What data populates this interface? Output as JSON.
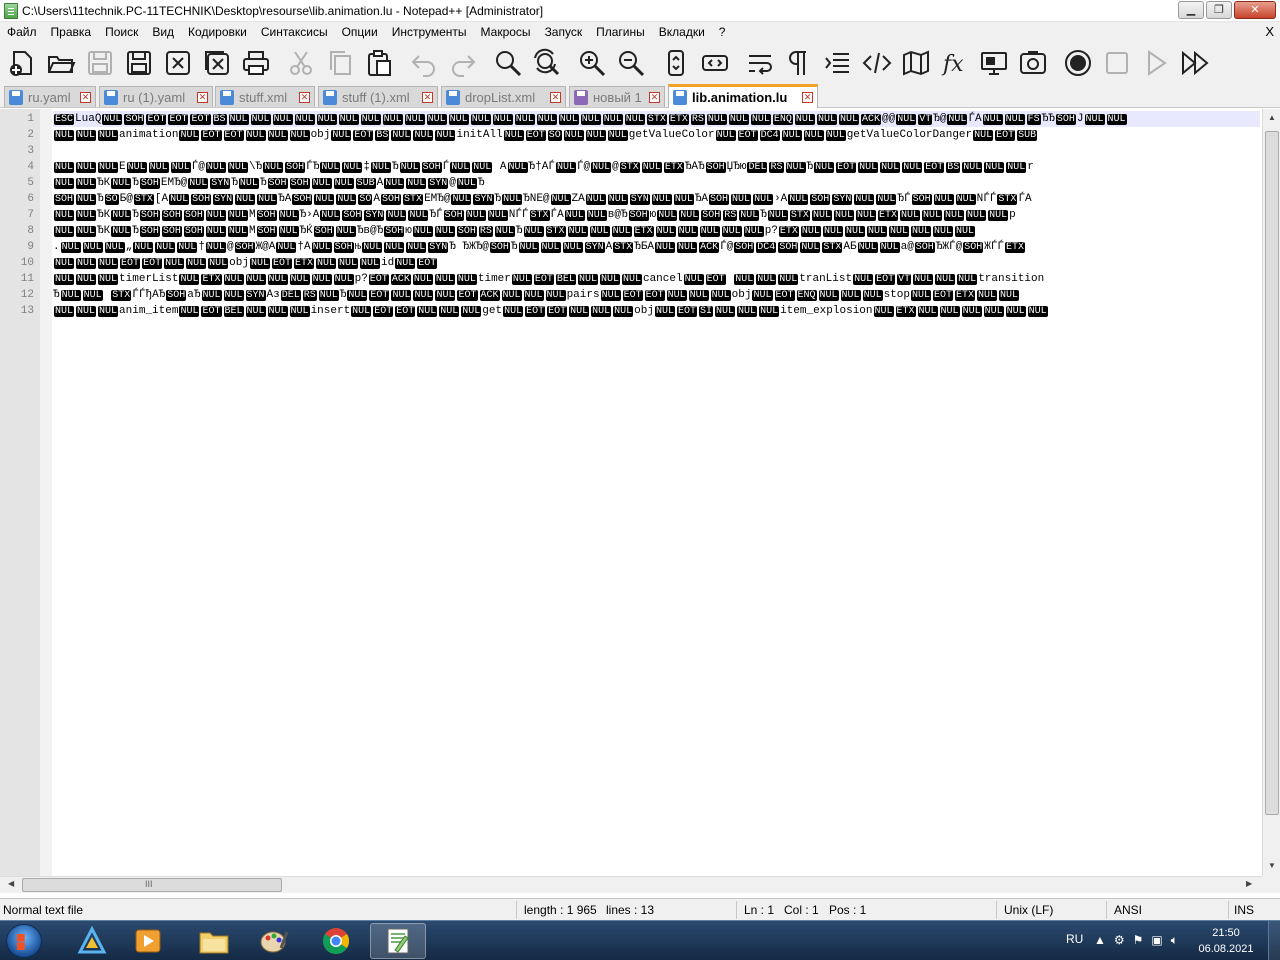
{
  "window": {
    "title": "C:\\Users\\11technik.PC-11TECHNIK\\Desktop\\resourse\\lib.animation.lu - Notepad++ [Administrator]"
  },
  "menu": {
    "items": [
      "Файл",
      "Правка",
      "Поиск",
      "Вид",
      "Кодировки",
      "Синтаксисы",
      "Опции",
      "Инструменты",
      "Макросы",
      "Запуск",
      "Плагины",
      "Вкладки",
      "?"
    ],
    "close": "X"
  },
  "toolbar": {
    "icons": [
      "new-file-icon",
      "open-file-icon",
      "save-icon",
      "save-all-icon",
      "close-icon",
      "close-all-icon",
      "print-icon",
      "cut-icon",
      "copy-icon",
      "paste-icon",
      "undo-icon",
      "redo-icon",
      "find-icon",
      "replace-icon",
      "zoom-in-icon",
      "zoom-out-icon",
      "sync-vertical-icon",
      "sync-horizontal-icon",
      "word-wrap-icon",
      "show-all-chars-icon",
      "indent-guide-icon",
      "xml-tag-icon",
      "document-map-icon",
      "function-list-icon",
      "monitor-icon",
      "folder-as-workspace-icon",
      "record-macro-icon",
      "stop-macro-icon",
      "play-macro-icon",
      "run-macro-multiple-icon"
    ]
  },
  "tabs": [
    {
      "label": "ru.yaml",
      "color": "blue",
      "active": false
    },
    {
      "label": "ru (1).yaml",
      "color": "blue",
      "active": false
    },
    {
      "label": "stuff.xml",
      "color": "blue",
      "active": false
    },
    {
      "label": "stuff (1).xml",
      "color": "blue",
      "active": false
    },
    {
      "label": "dropList.xml",
      "color": "blue",
      "active": false
    },
    {
      "label": "новый 1",
      "color": "purple",
      "active": false
    },
    {
      "label": "lib.animation.lu",
      "color": "blue",
      "active": true
    }
  ],
  "editor": {
    "line_numbers": [
      "1",
      "2",
      "3",
      "4",
      "5",
      "6",
      "7",
      "8",
      "9",
      "10",
      "11",
      "12",
      "13"
    ],
    "lines": [
      "[ESC]LuaQ[NUL][SOH][EOT][EOT][EOT][BS][NUL][NUL][NUL][NUL][NUL][NUL][NUL][NUL][NUL][NUL][NUL][NUL][NUL][NUL][NUL][NUL][NUL][NUL][NUL][STX][ETX][RS][NUL][NUL][NUL][ENQ][NUL][NUL][NUL][ACK]@@[NUL][VT]Ђ@[NUL]ЃА[NUL][NUL][FS]ЂЂ[SOH]Ј[NUL][NUL]",
      "[NUL][NUL][NUL]animation[NUL][EOT][EOT][NUL][NUL][NUL]obj[NUL][EOT][BS][NUL][NUL][NUL]initAll[NUL][EOT][SO][NUL][NUL][NUL]getValueColor[NUL][EOT][DC4][NUL][NUL][NUL]getValueColorDanger[NUL][EOT][SUB]",
      "",
      "[NUL][NUL][NUL]E[NUL][NUL][NUL]Ѓ@[NUL][NUL]\\Ђ[NUL][SOH]ЃЂ[NUL][NUL]‡[NUL]Ђ[NUL][SOH]Ѓ[NUL][NUL] А[NUL]Ђ†АЃ[NUL]Ѓ@[NUL]@[STX][NUL][ETX]ЂАЂ[SOH]ЏЂю[DEL][RS][NUL]Ђ[NUL][EOT][NUL][NUL][NUL][EOT][BS][NUL][NUL][NUL]r",
      "[NUL][NUL]ЂК[NUL]Ђ[SOH]ЕМЂ@[NUL][SYN]Ђ[NUL]Ђ[SOH][SOH][NUL][NUL][SUB]А[NUL][NUL][SYN]@[NUL]Ђ",
      "[SOH][NUL]Ђ[SO]Б@[STX][А[NUL][SOH][SYN][NUL][NUL]ЂА[SOH][NUL][NUL][SO]А[SOH][STX]ЕМЂ@[NUL][SYN]Ђ[NUL]ЂNЕ@[NUL]ZА[NUL][NUL][SYN][NUL][NUL]ЂА[SOH][NUL][NUL]›А[NUL][SOH][SYN][NUL][NUL]ЂЃ[SOH][NUL][NUL]NЃЃ[STX]ЃА",
      "[NUL][NUL]ЂК[NUL]Ђ[SOH][SOH][SOH][NUL][NUL]М[SOH][NUL]Ђ›А[NUL][SOH][SYN][NUL][NUL]ЂЃ[SOH][NUL][NUL]NЃЃ[STX]ЃА[NUL][NUL]в@Ђ[SOH]ю[NUL][NUL][SOH][RS][NUL]Ђ[NUL][STX][NUL][NUL][NUL][ETX][NUL][NUL][NUL][NUL][NUL]p",
      "[NUL][NUL]ЂК[NUL]Ђ[SOH][SOH][SOH][NUL][NUL]М[SOH][NUL]ЂЌ[SOH][NUL]Ђв@Ђ[SOH]ю[NUL][NUL][SOH][RS][NUL]Ђ[NUL][STX][NUL][NUL][NUL][ETX][NUL][NUL][NUL][NUL][NUL]p?[ETX][NUL][NUL][NUL][NUL][NUL][NUL][NUL][NUL]",
      ".[NUL][NUL][NUL]„[NUL][NUL][NUL]†[NUL]@[SOH]Ж@А[NUL]†А[NUL][SOH]њ[NUL][NUL][NUL][SYN]Ђ  ЂЖЂ@[SOH]Ђ[NUL][NUL][NUL][SYN]А[STX]ЂБА[NUL][NUL][ACK]Ѓ@[SOH][DC4][SOH][NUL][STX]АБ[NUL][NUL]а@[SOH]ЂЖЃ@[SOH]ЖЃЃ[ETX]",
      "[NUL][NUL][NUL][EOT][EOT][NUL][NUL][NUL]obj[NUL][EOT][ETX][NUL][NUL][NUL]id[NUL][EOT]",
      "[NUL][NUL][NUL]timerList[NUL][ETX][NUL][NUL][NUL][NUL][NUL][NUL]p?[EOT][ACK][NUL][NUL][NUL]timer[NUL][EOT][BEL][NUL][NUL][NUL]cancel[NUL][EOT] [NUL][NUL][NUL]tranList[NUL][EOT][VT][NUL][NUL][NUL]transition",
      "Ђ[NUL][NUL]     [STX]ЃЃђАЂ[SOH]аЂ[NUL][NUL][SYN]Аз[DEL][RS][NUL]Ђ[NUL][EOT][NUL][NUL][NUL][EOT][ACK][NUL][NUL][NUL]pairs[NUL][EOT][EOT][NUL][NUL][NUL]obj[NUL][EOT][ENQ][NUL][NUL][NUL]stop[NUL][EOT][ETX][NUL][NUL]",
      "[NUL][NUL][NUL]anim_item[NUL][EOT][BEL][NUL][NUL][NUL]insert[NUL][EOT][EOT][NUL][NUL][NUL]get[NUL][EOT][EOT][NUL][NUL][NUL]obj[NUL][EOT][SI][NUL][NUL][NUL]item_explosion[NUL][ETX][NUL][NUL][NUL][NUL][NUL][NUL]"
    ],
    "scroll_grip": "III"
  },
  "status": {
    "file_type": "Normal text file",
    "length": "length : 1 965",
    "lines": "lines : 13",
    "ln": "Ln : 1",
    "col": "Col : 1",
    "pos": "Pos : 1",
    "eol": "Unix (LF)",
    "encoding": "ANSI",
    "mode": "INS"
  },
  "taskbar": {
    "apps": [
      "start-button",
      "aimp-icon",
      "media-player-icon",
      "file-explorer-icon",
      "paint-icon",
      "chrome-icon",
      "notepadpp-icon"
    ],
    "language": "RU",
    "time": "21:50",
    "date": "06.08.2021"
  },
  "colors": {
    "active_tab_accent": "#f3a229",
    "current_line": "#e8e8ff",
    "control_char_bg": "#000000"
  }
}
